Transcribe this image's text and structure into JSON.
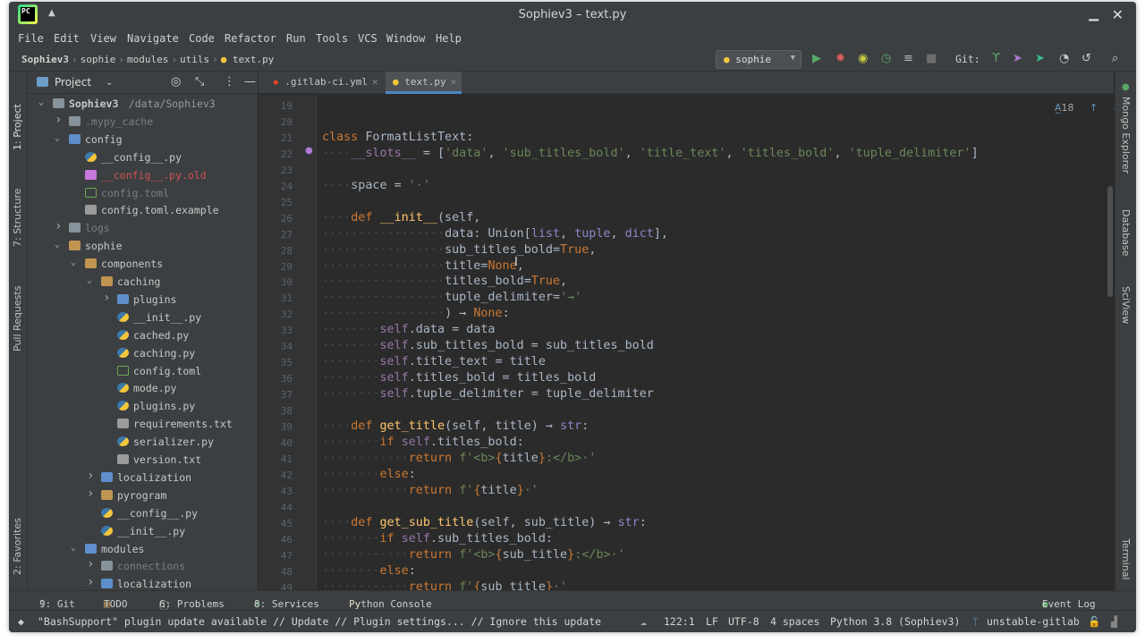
{
  "window": {
    "title": "Sophiev3 – text.py"
  },
  "menu": [
    "File",
    "Edit",
    "View",
    "Navigate",
    "Code",
    "Refactor",
    "Run",
    "Tools",
    "VCS",
    "Window",
    "Help"
  ],
  "breadcrumbs": [
    "Sophiev3",
    "sophie",
    "modules",
    "utils",
    "text.py"
  ],
  "toolbar": {
    "run_config": "sophie",
    "git_label": "Git:"
  },
  "tabs": [
    {
      "label": ".gitlab-ci.yml",
      "active": false
    },
    {
      "label": "text.py",
      "active": true
    }
  ],
  "left_strip": [
    "1: Project",
    "7: Structure",
    "Pull Requests",
    "2: Favorites"
  ],
  "right_strip": [
    "Mongo Explorer",
    "Database",
    "SciView",
    "Terminal"
  ],
  "project_panel": {
    "title": "Project",
    "tree": [
      {
        "label": "Sophiev3",
        "extra": "/data/Sophiev3",
        "indent": 0,
        "arrow": "v",
        "icon": "folder"
      },
      {
        "label": ".mypy_cache",
        "indent": 1,
        "arrow": ">",
        "icon": "folder",
        "style": "dim"
      },
      {
        "label": "config",
        "indent": 1,
        "arrow": "v",
        "icon": "folder src"
      },
      {
        "label": "__config__.py",
        "indent": 2,
        "icon": "py"
      },
      {
        "label": "__config__.py.old",
        "indent": 2,
        "icon": "old",
        "style": "red"
      },
      {
        "label": "config.toml",
        "indent": 2,
        "icon": "toml",
        "style": "dim"
      },
      {
        "label": "config.toml.example",
        "indent": 2,
        "icon": "txt"
      },
      {
        "label": "logs",
        "indent": 1,
        "arrow": ">",
        "icon": "folder",
        "style": "dim"
      },
      {
        "label": "sophie",
        "indent": 1,
        "arrow": "v",
        "icon": "folder pkg"
      },
      {
        "label": "components",
        "indent": 2,
        "arrow": "v",
        "icon": "folder pkg"
      },
      {
        "label": "caching",
        "indent": 3,
        "arrow": "v",
        "icon": "folder pkg"
      },
      {
        "label": "plugins",
        "indent": 4,
        "arrow": ">",
        "icon": "folder src"
      },
      {
        "label": "__init__.py",
        "indent": 4,
        "icon": "py"
      },
      {
        "label": "cached.py",
        "indent": 4,
        "icon": "py"
      },
      {
        "label": "caching.py",
        "indent": 4,
        "icon": "py"
      },
      {
        "label": "config.toml",
        "indent": 4,
        "icon": "toml"
      },
      {
        "label": "mode.py",
        "indent": 4,
        "icon": "py"
      },
      {
        "label": "plugins.py",
        "indent": 4,
        "icon": "py"
      },
      {
        "label": "requirements.txt",
        "indent": 4,
        "icon": "txt"
      },
      {
        "label": "serializer.py",
        "indent": 4,
        "icon": "py"
      },
      {
        "label": "version.txt",
        "indent": 4,
        "icon": "txt"
      },
      {
        "label": "localization",
        "indent": 3,
        "arrow": ">",
        "icon": "folder src"
      },
      {
        "label": "pyrogram",
        "indent": 3,
        "arrow": ">",
        "icon": "folder pkg"
      },
      {
        "label": "__config__.py",
        "indent": 3,
        "icon": "py"
      },
      {
        "label": "__init__.py",
        "indent": 3,
        "icon": "py"
      },
      {
        "label": "modules",
        "indent": 2,
        "arrow": "v",
        "icon": "folder src"
      },
      {
        "label": "connections",
        "indent": 3,
        "arrow": ">",
        "icon": "folder",
        "style": "dim"
      },
      {
        "label": "localization",
        "indent": 3,
        "arrow": ">",
        "icon": "folder src"
      }
    ]
  },
  "editor": {
    "inspection_count": "18",
    "lines": [
      {
        "n": "19",
        "html": ""
      },
      {
        "n": "20",
        "html": ""
      },
      {
        "n": "21",
        "html": "<span class='k'>class</span> FormatListText:"
      },
      {
        "n": "22",
        "html": "<span class='ws'>····</span><span class='sf'>__slots__</span> = [<span class='s'>'data'</span>, <span class='s'>'sub_titles_bold'</span>, <span class='s'>'title_text'</span>, <span class='s'>'titles_bold'</span>, <span class='s'>'tuple_delimiter'</span>]"
      },
      {
        "n": "23",
        "html": ""
      },
      {
        "n": "24",
        "html": "<span class='ws'>····</span>space = <span class='s'>'·'</span>"
      },
      {
        "n": "25",
        "html": ""
      },
      {
        "n": "26",
        "html": "<span class='ws'>····</span><span class='k'>def</span> <span class='fn'>__init__</span>(self,"
      },
      {
        "n": "27",
        "html": "<span class='ws'>·················</span>data: Union[<span class='bi'>list</span>, <span class='bi'>tuple</span>, <span class='bi'>dict</span>],"
      },
      {
        "n": "28",
        "html": "<span class='ws'>·················</span>sub_titles_bold=<span class='k'>True</span>,"
      },
      {
        "n": "29",
        "html": "<span class='ws'>·················</span>title=<span class='k'>None</span>,"
      },
      {
        "n": "30",
        "html": "<span class='ws'>·················</span>titles_bold=<span class='k'>True</span>,"
      },
      {
        "n": "31",
        "html": "<span class='ws'>·················</span>tuple_delimiter=<span class='s'>'→'</span>"
      },
      {
        "n": "32",
        "html": "<span class='ws'>·················</span>) → <span class='k'>None</span>:"
      },
      {
        "n": "33",
        "html": "<span class='ws'>········</span><span class='sf'>self</span>.data = data"
      },
      {
        "n": "34",
        "html": "<span class='ws'>········</span><span class='sf'>self</span>.sub_titles_bold = sub_titles_bold"
      },
      {
        "n": "35",
        "html": "<span class='ws'>········</span><span class='sf'>self</span>.title_text = title"
      },
      {
        "n": "36",
        "html": "<span class='ws'>········</span><span class='sf'>self</span>.titles_bold = titles_bold"
      },
      {
        "n": "37",
        "html": "<span class='ws'>········</span><span class='sf'>self</span>.tuple_delimiter = tuple_delimiter"
      },
      {
        "n": "38",
        "html": ""
      },
      {
        "n": "39",
        "html": "<span class='ws'>····</span><span class='k'>def</span> <span class='fn'>get_title</span>(self, title) → <span class='bi'>str</span>:"
      },
      {
        "n": "40",
        "html": "<span class='ws'>········</span><span class='k'>if</span> <span class='sf'>self</span>.titles_bold:"
      },
      {
        "n": "41",
        "html": "<span class='ws'>············</span><span class='k'>return</span> <span class='s'>f'&lt;b&gt;</span><span class='fmt'>{</span>title<span class='fmt'>}</span><span class='s'>:&lt;/b&gt;·'</span>"
      },
      {
        "n": "42",
        "html": "<span class='ws'>········</span><span class='k'>else</span>:"
      },
      {
        "n": "43",
        "html": "<span class='ws'>············</span><span class='k'>return</span> <span class='s'>f'</span><span class='fmt'>{</span>title<span class='fmt'>}</span><span class='s'>·'</span>"
      },
      {
        "n": "44",
        "html": ""
      },
      {
        "n": "45",
        "html": "<span class='ws'>····</span><span class='k'>def</span> <span class='fn'>get_sub_title</span>(self, sub_title) → <span class='bi'>str</span>:"
      },
      {
        "n": "46",
        "html": "<span class='ws'>········</span><span class='k'>if</span> <span class='sf'>self</span>.sub_titles_bold:"
      },
      {
        "n": "47",
        "html": "<span class='ws'>············</span><span class='k'>return</span> <span class='s'>f'&lt;b&gt;</span><span class='fmt'>{</span>sub_title<span class='fmt'>}</span><span class='s'>:&lt;/b&gt;·'</span>"
      },
      {
        "n": "48",
        "html": "<span class='ws'>········</span><span class='k'>else</span>:"
      },
      {
        "n": "49",
        "html": "<span class='ws'>············</span><span class='k'>return</span> <span class='s'>f'</span><span class='fmt'>{</span>sub_title<span class='fmt'>}</span><span class='s'>·'</span>"
      }
    ]
  },
  "tool_windows": [
    {
      "label": "9: Git"
    },
    {
      "label": "TODO"
    },
    {
      "label": "6: Problems"
    },
    {
      "label": "8: Services"
    },
    {
      "label": "Python Console"
    },
    {
      "label": "Event Log"
    }
  ],
  "status": {
    "message": "\"BashSupport\" plugin update available // Update // Plugin settings... // Ignore this update",
    "position": "122:1",
    "line_sep": "LF",
    "encoding": "UTF-8",
    "indent": "4 spaces",
    "interpreter": "Python 3.8 (Sophiev3)",
    "branch": "unstable-gitlab"
  }
}
